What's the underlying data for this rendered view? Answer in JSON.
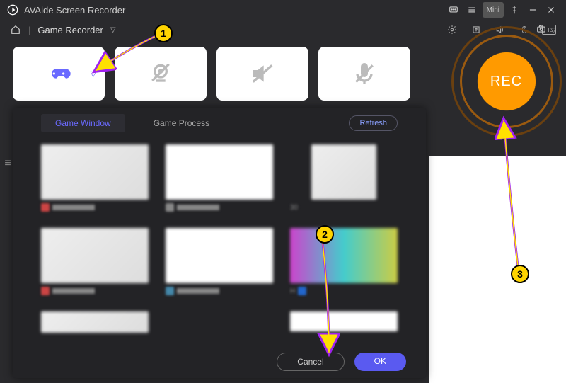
{
  "titlebar": {
    "app_name": "AVAide Screen Recorder",
    "mini_label": "Mini"
  },
  "dropdown": {
    "label": "Game Recorder"
  },
  "rec": {
    "label": "REC"
  },
  "panel": {
    "tab_window": "Game Window",
    "tab_process": "Game Process",
    "refresh": "Refresh",
    "cancel": "Cancel",
    "ok": "OK",
    "caption_30": "30",
    "caption_h": "H"
  },
  "badges": {
    "b1": "1",
    "b2": "2",
    "b3": "3"
  }
}
